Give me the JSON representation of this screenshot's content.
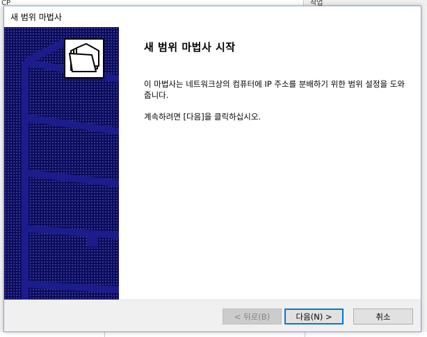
{
  "background": {
    "left_label": "CP",
    "right_label": "작업"
  },
  "dialog": {
    "title": "새 범위 마법사"
  },
  "content": {
    "heading": "새 범위 마법사 시작",
    "paragraph1": "이 마법사는 네트워크상의 컴퓨터에 IP 주소를 분배하기 위한 범위 설정을 도와줍니다.",
    "paragraph2": "계속하려면 [다음]을 클릭하십시오."
  },
  "buttons": {
    "back": "< 뒤로(B)",
    "next": "다음(N) >",
    "cancel": "취소"
  },
  "icons": {
    "banner": "folder-stack-icon"
  },
  "colors": {
    "side_panel": "#0b0b5e",
    "focus_border": "#0078d7"
  }
}
